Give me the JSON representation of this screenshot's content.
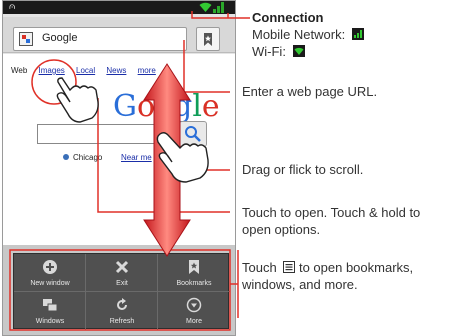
{
  "colors": {
    "accent_red": "#e03128",
    "wifi_green": "#32c832",
    "signal_green": "#2aa82a"
  },
  "status_bar": {
    "voicemail_icon": "voicemail-icon",
    "wifi_icon": "wifi-icon",
    "signal_icon": "signal-icon"
  },
  "browser": {
    "url_field": "Google",
    "favicon": "google-favicon",
    "bookmark_icon": "bookmark-icon",
    "nav_links": [
      "Web",
      "Images",
      "Local",
      "News",
      "more"
    ],
    "logo_text": "Google",
    "location": "Chicago",
    "near_me": "Near me"
  },
  "menu": {
    "items": [
      {
        "label": "New window",
        "icon": "new-window-icon"
      },
      {
        "label": "Exit",
        "icon": "exit-icon"
      },
      {
        "label": "Bookmarks",
        "icon": "bookmarks-icon"
      },
      {
        "label": "Windows",
        "icon": "windows-icon"
      },
      {
        "label": "Refresh",
        "icon": "refresh-icon"
      },
      {
        "label": "More",
        "icon": "more-icon"
      }
    ]
  },
  "callouts": {
    "connection_title": "Connection",
    "mobile_network": "Mobile Network:",
    "wifi": "Wi-Fi:",
    "url": "Enter a web page URL.",
    "scroll": "Drag or flick to scroll.",
    "touch_open_1": "Touch to open. Touch & hold to",
    "touch_open_2": "open options.",
    "menu_1_pre": "Touch",
    "menu_1_post": "to open bookmarks,",
    "menu_2": "windows, and more."
  }
}
